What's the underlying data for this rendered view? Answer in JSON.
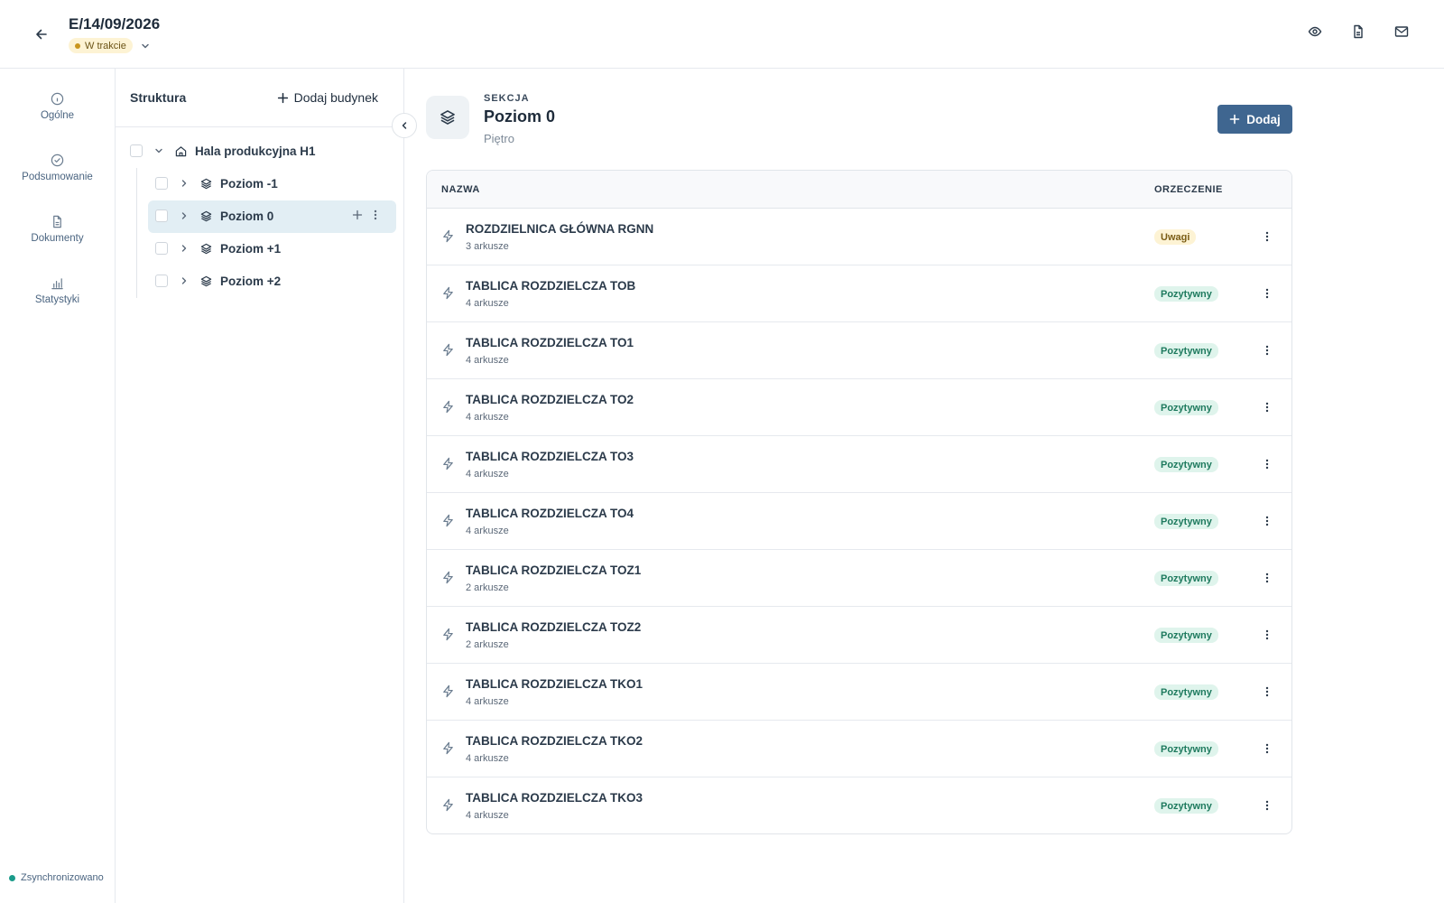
{
  "header": {
    "doc_number": "E/14/09/2026",
    "status": "W trakcie"
  },
  "nav": {
    "items": [
      {
        "label": "Ogólne",
        "icon": "info-icon"
      },
      {
        "label": "Podsumowanie",
        "icon": "check-circle-icon"
      },
      {
        "label": "Dokumenty",
        "icon": "document-icon"
      },
      {
        "label": "Statystyki",
        "icon": "bar-chart-icon"
      }
    ],
    "sync_label": "Zsynchronizowano"
  },
  "tree": {
    "title": "Struktura",
    "add_building_label": "Dodaj budynek",
    "building": "Hala produkcyjna H1",
    "levels": [
      {
        "label": "Poziom -1",
        "selected": false
      },
      {
        "label": "Poziom 0",
        "selected": true
      },
      {
        "label": "Poziom +1",
        "selected": false
      },
      {
        "label": "Poziom +2",
        "selected": false
      }
    ]
  },
  "section": {
    "kicker": "SEKCJA",
    "title": "Poziom 0",
    "subtitle": "Piętro",
    "add_label": "Dodaj"
  },
  "table": {
    "col_name": "NAZWA",
    "col_verdict": "ORZECZENIE",
    "rows": [
      {
        "name": "ROZDZIELNICA GŁÓWNA RGNN",
        "sheets": "3 arkusze",
        "verdict": "Uwagi",
        "verdict_type": "warn"
      },
      {
        "name": "TABLICA ROZDZIELCZA TOB",
        "sheets": "4 arkusze",
        "verdict": "Pozytywny",
        "verdict_type": "pos"
      },
      {
        "name": "TABLICA ROZDZIELCZA TO1",
        "sheets": "4 arkusze",
        "verdict": "Pozytywny",
        "verdict_type": "pos"
      },
      {
        "name": "TABLICA ROZDZIELCZA TO2",
        "sheets": "4 arkusze",
        "verdict": "Pozytywny",
        "verdict_type": "pos"
      },
      {
        "name": "TABLICA ROZDZIELCZA TO3",
        "sheets": "4 arkusze",
        "verdict": "Pozytywny",
        "verdict_type": "pos"
      },
      {
        "name": "TABLICA ROZDZIELCZA TO4",
        "sheets": "4 arkusze",
        "verdict": "Pozytywny",
        "verdict_type": "pos"
      },
      {
        "name": "TABLICA ROZDZIELCZA TOZ1",
        "sheets": "2 arkusze",
        "verdict": "Pozytywny",
        "verdict_type": "pos"
      },
      {
        "name": "TABLICA ROZDZIELCZA TOZ2",
        "sheets": "2 arkusze",
        "verdict": "Pozytywny",
        "verdict_type": "pos"
      },
      {
        "name": "TABLICA ROZDZIELCZA TKO1",
        "sheets": "4 arkusze",
        "verdict": "Pozytywny",
        "verdict_type": "pos"
      },
      {
        "name": "TABLICA ROZDZIELCZA TKO2",
        "sheets": "4 arkusze",
        "verdict": "Pozytywny",
        "verdict_type": "pos"
      },
      {
        "name": "TABLICA ROZDZIELCZA TKO3",
        "sheets": "4 arkusze",
        "verdict": "Pozytywny",
        "verdict_type": "pos"
      }
    ]
  }
}
